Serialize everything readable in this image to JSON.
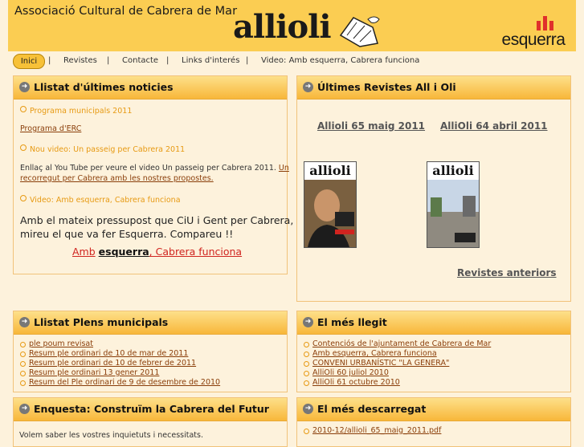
{
  "header": {
    "site_title": "Associació Cultural de Cabrera de Mar",
    "brand": "allioli",
    "partner_logo": "esquerra",
    "colors": {
      "header_bg": "#fbcd52",
      "page_bg": "#fdf2dc",
      "link_orange": "#e79a13",
      "link_brown": "#8a3e0a",
      "esquerra_red": "#e0302b"
    }
  },
  "nav": {
    "items": [
      "Inici",
      "Revistes",
      "Contacte",
      "Links d'interés",
      "Video: Amb esquerra, Cabrera funciona"
    ],
    "separator": "|"
  },
  "news": {
    "title": "Llistat d'últimes noticies",
    "item1_title": "Programa municipals 2011",
    "item1_link": "Programa d'ERC",
    "item2_title": "Nou video: Un passeig per Cabrera 2011",
    "item2_text": "Enllaç al You Tube per veure el video Un passeig per Cabrera 2011.",
    "item2_link_a": "Un",
    "item2_link_b": "recorregut per Cabrera amb les nostres propostes.",
    "item3_title": "Video: Amb esquerra, Cabrera funciona",
    "item3_text_a": "Amb el mateix pressupost que CiU i Gent per Cabrera,",
    "item3_text_b": "mireu el que va fer Esquerra. Compareu !!",
    "item3_link_a": "Amb",
    "item3_link_b": "esquerra",
    "item3_link_c": ", Cabrera funciona"
  },
  "revistes": {
    "title": "Últimes Revistes All i Oli",
    "issue1": "Allioli 65 maig 2011",
    "issue2": "AlliOli 64 abril 2011",
    "cover_mast": "allioli",
    "more": "Revistes anteriors"
  },
  "plens": {
    "title": "Llistat Plens municipals",
    "items": [
      "ple poum revisat",
      "Resum ple ordinari de 10 de mar de 2011",
      "Resum ple ordinari de 10 de febrer de 2011",
      "Resum ple ordinari 13 gener 2011",
      "Resum del Ple ordinari de 9 de desembre de 2010"
    ]
  },
  "mes_llegit": {
    "title": "El més llegit",
    "items": [
      "Contenciós de l'ajuntament de Cabrera de Mar",
      "Amb esquerra, Cabrera funciona",
      "CONVENI URBANÍSTIC \"LA GENERA\"",
      "AlliOli 60 juliol 2010",
      "AlliOli 61 octubre 2010"
    ]
  },
  "enquesta": {
    "title": "Enquesta: Construïm la Cabrera del Futur",
    "text": "Volem saber les vostres inquietuts i necessitats."
  },
  "mes_descarregat": {
    "title": "El més descarregat",
    "items": [
      "2010-12/allioli_65_maig_2011.pdf"
    ]
  },
  "icons": {
    "panel_header": "arrow-circle-icon",
    "brand_mark": "garlic-icon",
    "logo_mark": "esquerra-bars-icon"
  }
}
